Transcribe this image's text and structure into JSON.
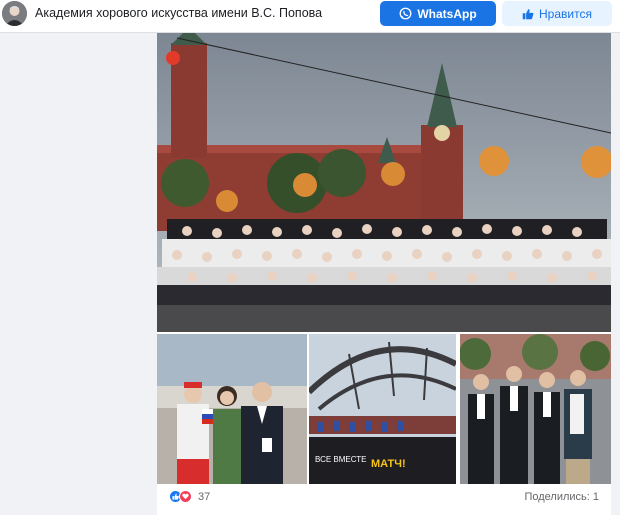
{
  "header": {
    "page_name": "Академия хорового искусства имени В.С. Попова",
    "avatar_icon": "person-portrait",
    "whatsapp_label": "WhatsApp",
    "like_label": "Нравится",
    "whatsapp_color": "#1b74e4",
    "like_bg": "#e7f3ff"
  },
  "post": {
    "photos": [
      {
        "icon": "choir-on-red-square-photo"
      },
      {
        "icon": "people-with-flag-photo"
      },
      {
        "icon": "stage-canopy-photo"
      },
      {
        "icon": "group-in-suits-photo"
      }
    ],
    "sticker_text": "ВСЕ ВМЕСТЕ",
    "logo_text": "МАТЧ!",
    "reaction_count": "37",
    "shares_text": "Поделились: 1"
  }
}
